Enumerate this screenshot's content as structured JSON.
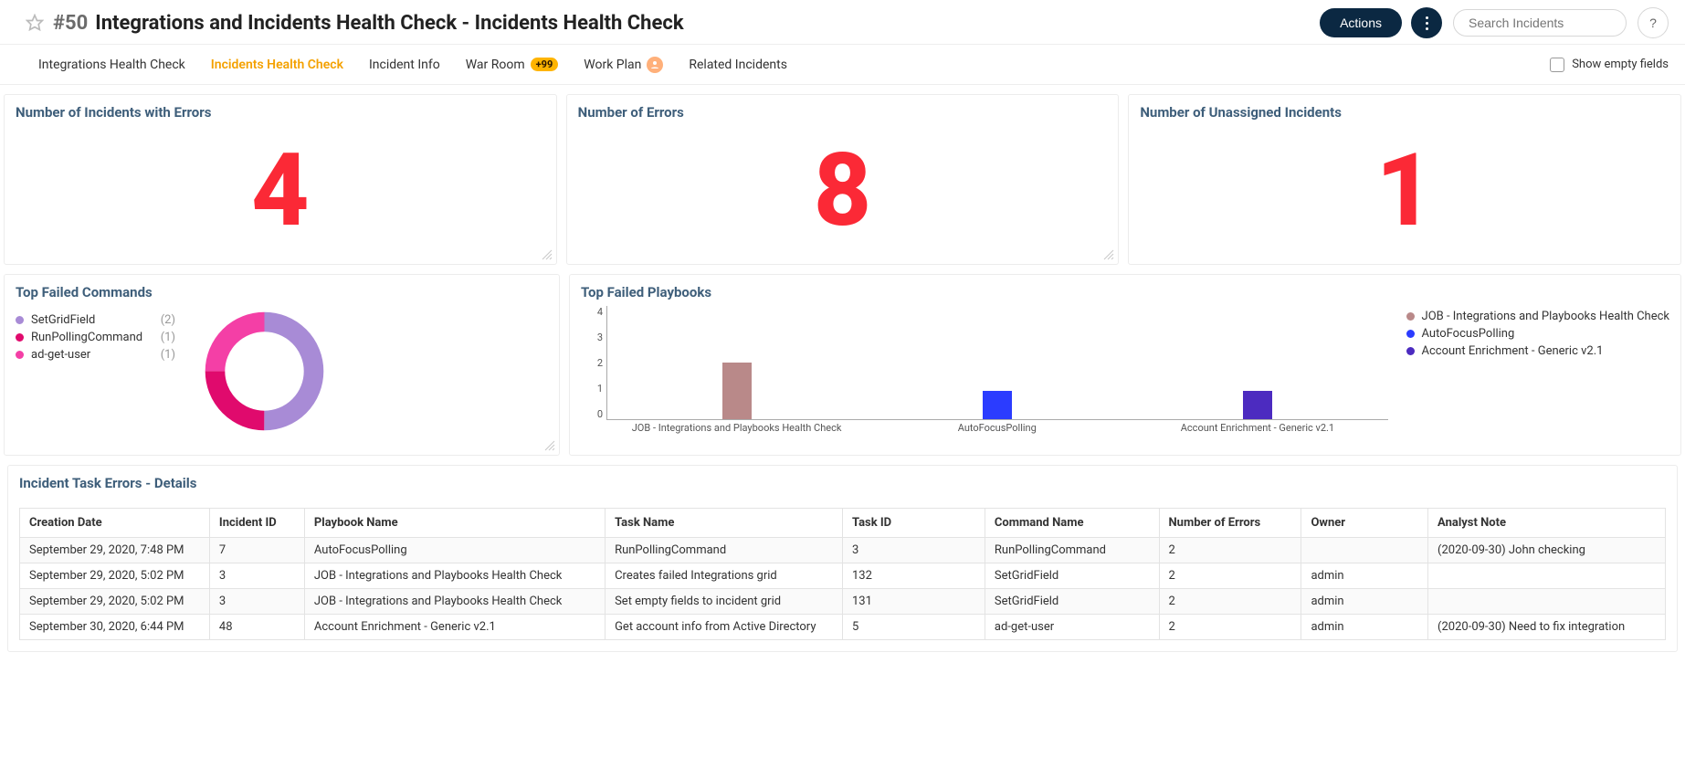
{
  "header": {
    "incident_number": "#50",
    "title": "Integrations and Incidents Health Check - Incidents Health Check",
    "actions_label": "Actions",
    "search_placeholder": "Search Incidents",
    "help_label": "?"
  },
  "tabs": {
    "items": [
      {
        "label": "Integrations Health Check",
        "active": false
      },
      {
        "label": "Incidents Health Check",
        "active": true
      },
      {
        "label": "Incident Info",
        "active": false
      },
      {
        "label": "War Room",
        "active": false,
        "badge": "+99"
      },
      {
        "label": "Work Plan",
        "active": false,
        "avatar": true
      },
      {
        "label": "Related Incidents",
        "active": false
      }
    ],
    "show_empty_label": "Show empty fields"
  },
  "metrics": {
    "incidents_errors": {
      "title": "Number of Incidents with Errors",
      "value": "4"
    },
    "errors": {
      "title": "Number of Errors",
      "value": "8"
    },
    "unassigned": {
      "title": "Number of Unassigned Incidents",
      "value": "1"
    }
  },
  "failed_commands": {
    "title": "Top Failed Commands",
    "items": [
      {
        "label": "SetGridField",
        "count": "(2)",
        "value": 2,
        "color": "#a88bd6"
      },
      {
        "label": "RunPollingCommand",
        "count": "(1)",
        "value": 1,
        "color": "#e00a6d"
      },
      {
        "label": "ad-get-user",
        "count": "(1)",
        "value": 1,
        "color": "#f43fa6"
      }
    ]
  },
  "failed_playbooks": {
    "title": "Top Failed Playbooks",
    "items": [
      {
        "label": "JOB - Integrations and Playbooks Health Check",
        "value": 2,
        "color": "#b98989"
      },
      {
        "label": "AutoFocusPolling",
        "value": 1,
        "color": "#2b3cff"
      },
      {
        "label": "Account Enrichment - Generic v2.1",
        "value": 1,
        "color": "#4c2bc0"
      }
    ],
    "ymax": 4,
    "yticks": [
      "4",
      "3",
      "2",
      "1",
      "0"
    ]
  },
  "chart_data": [
    {
      "type": "pie",
      "title": "Top Failed Commands",
      "series": [
        {
          "name": "SetGridField",
          "value": 2,
          "color": "#a88bd6"
        },
        {
          "name": "RunPollingCommand",
          "value": 1,
          "color": "#e00a6d"
        },
        {
          "name": "ad-get-user",
          "value": 1,
          "color": "#f43fa6"
        }
      ]
    },
    {
      "type": "bar",
      "title": "Top Failed Playbooks",
      "categories": [
        "JOB - Integrations and Playbooks Health Check",
        "AutoFocusPolling",
        "Account Enrichment - Generic v2.1"
      ],
      "values": [
        2,
        1,
        1
      ],
      "ylabel": "",
      "xlabel": "",
      "ylim": [
        0,
        4
      ]
    }
  ],
  "task_table": {
    "title": "Incident Task Errors - Details",
    "columns": [
      "Creation Date",
      "Incident ID",
      "Playbook Name",
      "Task Name",
      "Task ID",
      "Command Name",
      "Number of Errors",
      "Owner",
      "Analyst Note"
    ],
    "rows": [
      [
        "September 29, 2020, 7:48 PM",
        "7",
        "AutoFocusPolling",
        "RunPollingCommand",
        "3",
        "RunPollingCommand",
        "2",
        "",
        "(2020-09-30) John checking"
      ],
      [
        "September 29, 2020, 5:02 PM",
        "3",
        "JOB - Integrations and Playbooks Health Check",
        "Creates failed Integrations grid",
        "132",
        "SetGridField",
        "2",
        "admin",
        ""
      ],
      [
        "September 29, 2020, 5:02 PM",
        "3",
        "JOB - Integrations and Playbooks Health Check",
        "Set empty fields to incident grid",
        "131",
        "SetGridField",
        "2",
        "admin",
        ""
      ],
      [
        "September 30, 2020, 6:44 PM",
        "48",
        "Account Enrichment - Generic v2.1",
        "Get account info from Active Directory",
        "5",
        "ad-get-user",
        "2",
        "admin",
        "(2020-09-30) Need to fix integration"
      ]
    ]
  }
}
